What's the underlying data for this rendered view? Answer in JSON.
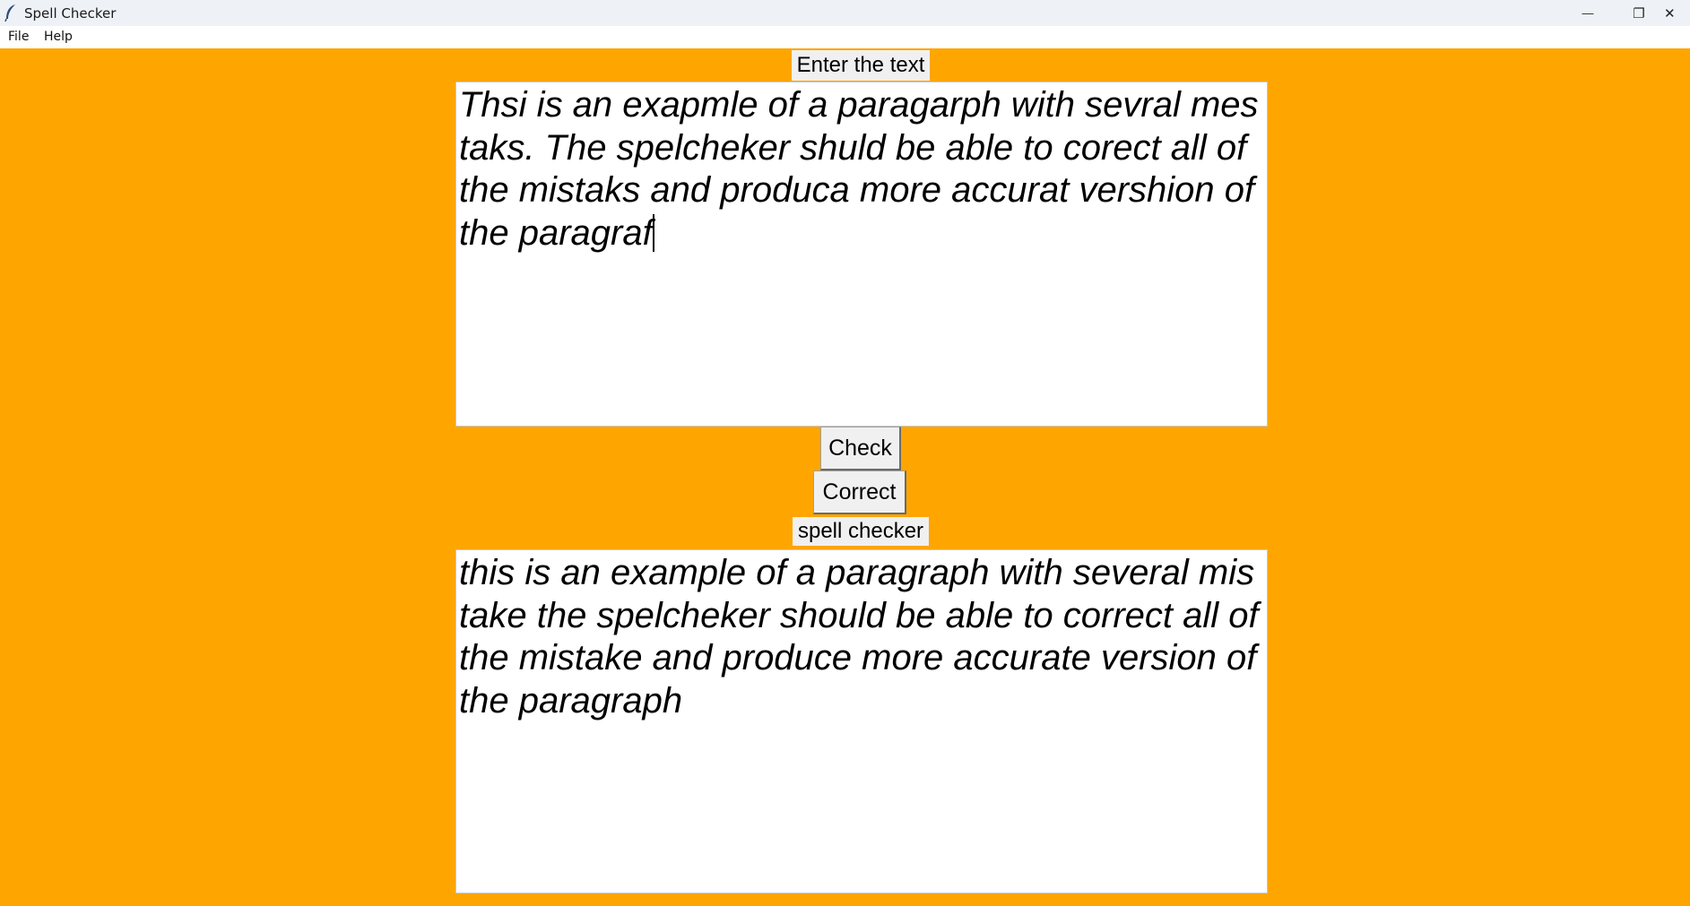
{
  "window": {
    "title": "Spell Checker",
    "minimize_glyph": "—",
    "restore_glyph": "❐",
    "close_glyph": "✕"
  },
  "menu": {
    "items": [
      "File",
      "Help"
    ]
  },
  "input_section": {
    "label": "Enter the text",
    "text": "Thsi is an exapmle of a paragarph with sevral mestaks. The spelcheker shuld be able to corect all of the mistaks and produca more accurat vershion of the paragraf"
  },
  "buttons": {
    "check_label": "Check",
    "correct_label": "Correct"
  },
  "output_section": {
    "label": "spell checker",
    "text": "this is an example of a paragraph with several mistake the spelcheker should be able to correct all of the mistake and produce more accurate version of the paragraph"
  },
  "colors": {
    "background": "#ffa500",
    "text_area": "#ffffff",
    "widget": "#f0f0f0"
  },
  "icons": {
    "app": "feather-icon"
  }
}
